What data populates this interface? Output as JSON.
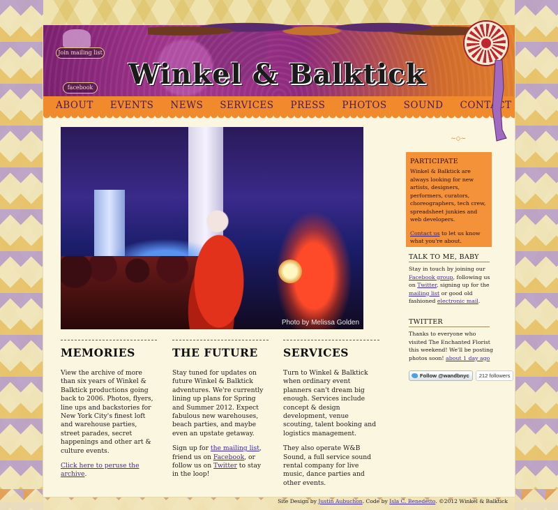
{
  "site": {
    "title": "Winkel & Balktick",
    "join_mailing_list": "Join mailing list",
    "facebook": "facebook"
  },
  "nav": {
    "items": [
      {
        "label": "ABOUT"
      },
      {
        "label": "EVENTS"
      },
      {
        "label": "NEWS"
      },
      {
        "label": "SERVICES"
      },
      {
        "label": "PRESS"
      },
      {
        "label": "PHOTOS"
      },
      {
        "label": "SOUND"
      },
      {
        "label": "CONTACT"
      }
    ]
  },
  "hero": {
    "credit": "Photo by Melissa Golden"
  },
  "columns": {
    "memories": {
      "heading": "MEMORIES",
      "body": "View the archive of more than six years of Winkel & Balktick productions going back to 2006. Photos, flyers, line ups and backstories for New York City's finest loft and warehouse parties, street parades, secret happenings and other art & culture events.",
      "link": "Click here to peruse the archive",
      "after_link": "."
    },
    "future": {
      "heading": "THE FUTURE",
      "body": "Stay tuned for updates on future Winkel & Balktick adventures. We're currently lining up plans for Spring and Summer 2012. Expect fabulous new warehouses, beach parties, and maybe even an upstate getaway.",
      "signup_pre": "Sign up for ",
      "signup_link": "the mailing list",
      "signup_mid": ", friend us on ",
      "facebook_link": "Facebook",
      "signup_mid2": ", or follow us on ",
      "twitter_link": "Twitter",
      "signup_post": " to stay in the loop!"
    },
    "services": {
      "heading": "SERVICES",
      "body": "Turn to Winkel & Balktick when ordinary event planners can't dream big enough. Services include concept & design development, venue scouting, talent booking and logistics management.",
      "body2": "They also operate W&B Sound, a full service sound rental company for live music, dance parties and other events."
    }
  },
  "sidebar": {
    "participate": {
      "heading": "PARTICIPATE",
      "body": "Winkel & Balktick are always looking for new artists, designers, performers, curators, choreographers, tech crew, spreadsheet junkies and web developers.",
      "contact_link": "Contact us",
      "contact_post": " to let us know what you're about."
    },
    "talk": {
      "heading": "TALK TO ME, BABY",
      "pre": "Stay in touch by joining our ",
      "facebook_group": "Facebook group",
      "mid1": ", following us on ",
      "twitter": "Twitter",
      "mid2": ", signing up for the ",
      "mailing_list": "mailing list",
      "mid3": " or good old fashioned ",
      "email": "electronic mail",
      "post": "."
    },
    "twitter": {
      "heading": "TWITTER",
      "tweet": "Thanks to everyone who visited The Enchanted Florist this weekend! We'll be posting photos soon! ",
      "time_link": "about 1 day ago",
      "follow_label": "Follow @wandbnyc",
      "followers": "212 followers"
    }
  },
  "footer": {
    "design_pre": "Site Design by ",
    "designer": "Justin Aubuchon",
    "code_pre": ". Code by ",
    "coder": "Isla C. Benedetto",
    "copyright": ". ©2012 Winkel & Balktick"
  },
  "colors": {
    "nav_orange": "#f08a2d",
    "nav_text": "#4b1a52",
    "link": "#3b2aa8",
    "banner_purple": "#8d2a7c",
    "participate_bg": "#f4923a"
  }
}
